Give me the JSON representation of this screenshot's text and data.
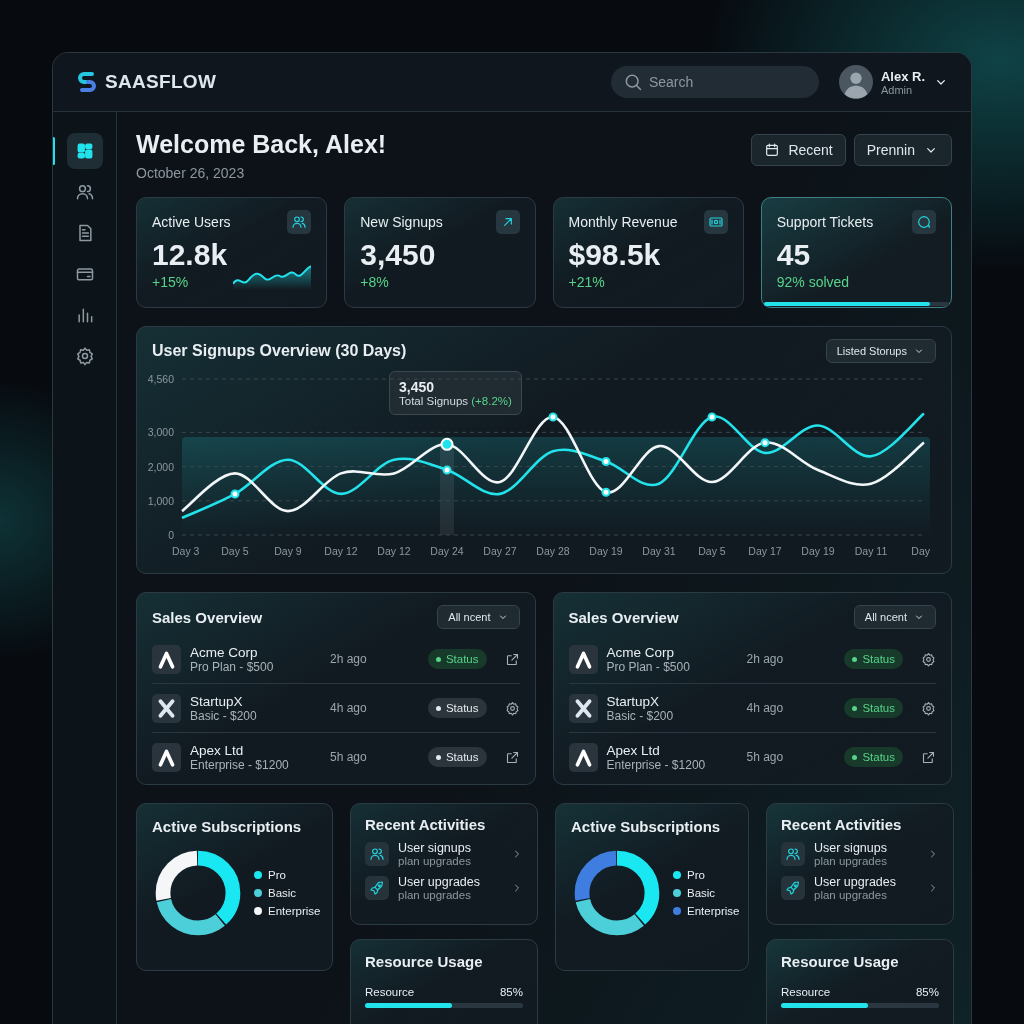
{
  "header": {
    "brand": "SAASFLOW",
    "search": {
      "placeholder": "Search"
    },
    "user": {
      "name": "Alex R.",
      "role": "Admin"
    }
  },
  "sidebar": {
    "items": [
      {
        "selected": true
      },
      {
        "selected": false
      },
      {
        "selected": false
      },
      {
        "selected": false
      },
      {
        "selected": false
      },
      {
        "selected": false
      }
    ]
  },
  "welcome": {
    "title": "Welcome Back, Alex!",
    "date": "October 26, 2023",
    "buttons": [
      {
        "label": "Recent",
        "kind": "calendar"
      },
      {
        "label": "Prennin",
        "kind": "dropdown"
      }
    ]
  },
  "kpis": [
    {
      "label": "Active Users",
      "value": "12.8k",
      "delta": "+15%",
      "selected": false
    },
    {
      "label": "New Signups",
      "value": "3,450",
      "delta": "+8%",
      "selected": false
    },
    {
      "label": "Monthly Revenue",
      "value": "$98.5k",
      "delta": "+21%",
      "selected": false
    },
    {
      "label": "Support Tickets",
      "value": "45",
      "delta": "92% solved",
      "selected": true,
      "level": 0.9
    }
  ],
  "signups": {
    "title": "User Signups Overview (30 Days)",
    "filter": "Listed Storups",
    "tooltip": {
      "value": "3,450",
      "label": "Total Signups *(+8.2%)*"
    },
    "chart_data": {
      "type": "line",
      "grid": true,
      "categories": [
        "Day 3",
        "Day 5",
        "Day 9",
        "Day 12",
        "Day 12",
        "Day 24",
        "Day 27",
        "Day 28",
        "Day 19",
        "Day 31",
        "Day 5",
        "Day 17",
        "Day 19",
        "Day 11",
        "Day"
      ],
      "series": [
        {
          "color": "#22e3ec",
          "values": [
            500,
            1200,
            2200,
            1200,
            2200,
            1900,
            1200,
            2450,
            2150,
            1500,
            3450,
            2400,
            3200,
            2300,
            3550
          ]
        },
        {
          "color": "#f2f6f8",
          "values": [
            700,
            1800,
            700,
            1800,
            1800,
            2650,
            1550,
            3450,
            1250,
            2600,
            1550,
            2700,
            1900,
            1500,
            2700
          ]
        }
      ],
      "ylim": [
        0,
        4560
      ],
      "yticks": [
        0,
        {
          "value": 1000,
          "label": "1,000"
        },
        {
          "value": 2000,
          "label": "2,000"
        },
        {
          "value": 3000,
          "label": "3,000"
        },
        {
          "value": 4560,
          "label": "4,560"
        }
      ]
    }
  },
  "sales_panels": [
    {
      "title": "Sales Overview",
      "filter": "All ncent",
      "rows": [
        {
          "logo": {
            "kind": "peak"
          },
          "name": "Acme Corp",
          "plan": "Pro Plan - $500",
          "time": "2h ago",
          "status": "Status",
          "active": true,
          "action": {
            "kind": "link"
          }
        },
        {
          "logo": {
            "kind": "cross"
          },
          "name": "StartupX",
          "plan": "Basic - $200",
          "time": "4h ago",
          "status": "Status",
          "active": false,
          "action": {
            "kind": "settings"
          }
        },
        {
          "logo": {
            "kind": "peak"
          },
          "name": "Apex Ltd",
          "plan": "Enterprise - $1200",
          "time": "5h ago",
          "status": "Status",
          "active": false,
          "action": {
            "kind": "link"
          }
        }
      ]
    },
    {
      "title": "Sales Overview",
      "filter": "All ncent",
      "rows": [
        {
          "logo": {
            "kind": "peak"
          },
          "name": "Acme Corp",
          "plan": "Pro Plan - $500",
          "time": "2h ago",
          "status": "Status",
          "active": true,
          "action": {
            "kind": "settings"
          }
        },
        {
          "logo": {
            "kind": "cross"
          },
          "name": "StartupX",
          "plan": "Basic - $200",
          "time": "4h ago",
          "status": "Status",
          "active": true,
          "action": {
            "kind": "settings"
          }
        },
        {
          "logo": {
            "kind": "peak"
          },
          "name": "Apex Ltd",
          "plan": "Enterprise - $1200",
          "time": "5h ago",
          "status": "Status",
          "active": true,
          "action": {
            "kind": "link"
          }
        }
      ]
    }
  ],
  "bottom_groups": [
    {
      "subscriptions": {
        "title": "Active Subscriptions",
        "legend": [
          {
            "label": "Pro",
            "color": "#19e8f2"
          },
          {
            "label": "Basic",
            "color": "#4ccfd9"
          },
          {
            "label": "Enterprise",
            "color": "#f4f6f7"
          }
        ]
      },
      "activities": {
        "title": "Recent Activities",
        "items": [
          {
            "title": "User signups",
            "subtitle": "plan upgrades"
          },
          {
            "title": "User upgrades",
            "subtitle": "plan upgrades"
          }
        ]
      },
      "resources": {
        "title": "Resource Usage",
        "items": [
          {
            "label": "Resource",
            "value": "85%",
            "level": 0.55
          }
        ]
      }
    },
    {
      "subscriptions": {
        "title": "Active Subscriptions",
        "legend": [
          {
            "label": "Pro",
            "color": "#19e8f2"
          },
          {
            "label": "Basic",
            "color": "#4ccfd9"
          },
          {
            "label": "Enterprise",
            "color": "#3f7ee0"
          }
        ]
      },
      "activities": {
        "title": "Recent Activities",
        "items": [
          {
            "title": "User signups",
            "subtitle": "plan upgrades"
          },
          {
            "title": "User upgrades",
            "subtitle": "plan upgrades"
          }
        ]
      },
      "resources": {
        "title": "Resource Usage",
        "items": [
          {
            "label": "Resource",
            "value": "85%",
            "level": 0.55
          }
        ]
      }
    }
  ]
}
